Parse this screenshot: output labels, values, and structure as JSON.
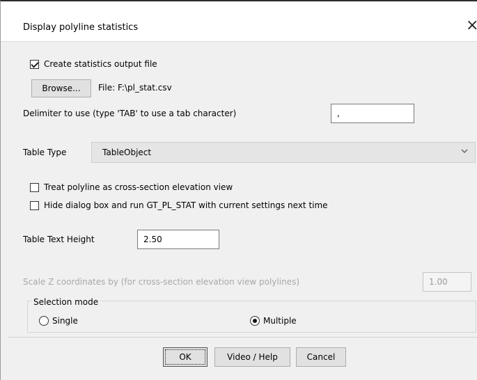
{
  "dialog": {
    "title": "Display polyline statistics",
    "close_glyph": "×"
  },
  "create_stats": {
    "label": "Create statistics output file",
    "checked": true
  },
  "browse": {
    "button_label": "Browse...",
    "file_text": "File: F:\\pl_stat.csv"
  },
  "delimiter": {
    "label": "Delimiter to use (type 'TAB' to use a tab character)",
    "value": ","
  },
  "table_type": {
    "label": "Table Type",
    "value": "TableObject"
  },
  "options": {
    "treat_cross_section": {
      "label": "Treat polyline as cross-section elevation view",
      "checked": false
    },
    "hide_dialog": {
      "label": "Hide dialog box and run GT_PL_STAT with current settings next time",
      "checked": false
    }
  },
  "text_height": {
    "label": "Table Text Height",
    "value": "2.50"
  },
  "scale_z": {
    "label": "Scale Z coordinates by (for cross-section elevation view polylines)",
    "value": "1.00",
    "enabled": false
  },
  "selection_mode": {
    "label": "Selection mode",
    "single_label": "Single",
    "multiple_label": "Multiple",
    "selected": "Multiple"
  },
  "buttons": {
    "ok": "OK",
    "help": "Video / Help",
    "cancel": "Cancel"
  },
  "icons": {
    "close": "close-icon",
    "dropdown": "chevron-down-icon"
  }
}
